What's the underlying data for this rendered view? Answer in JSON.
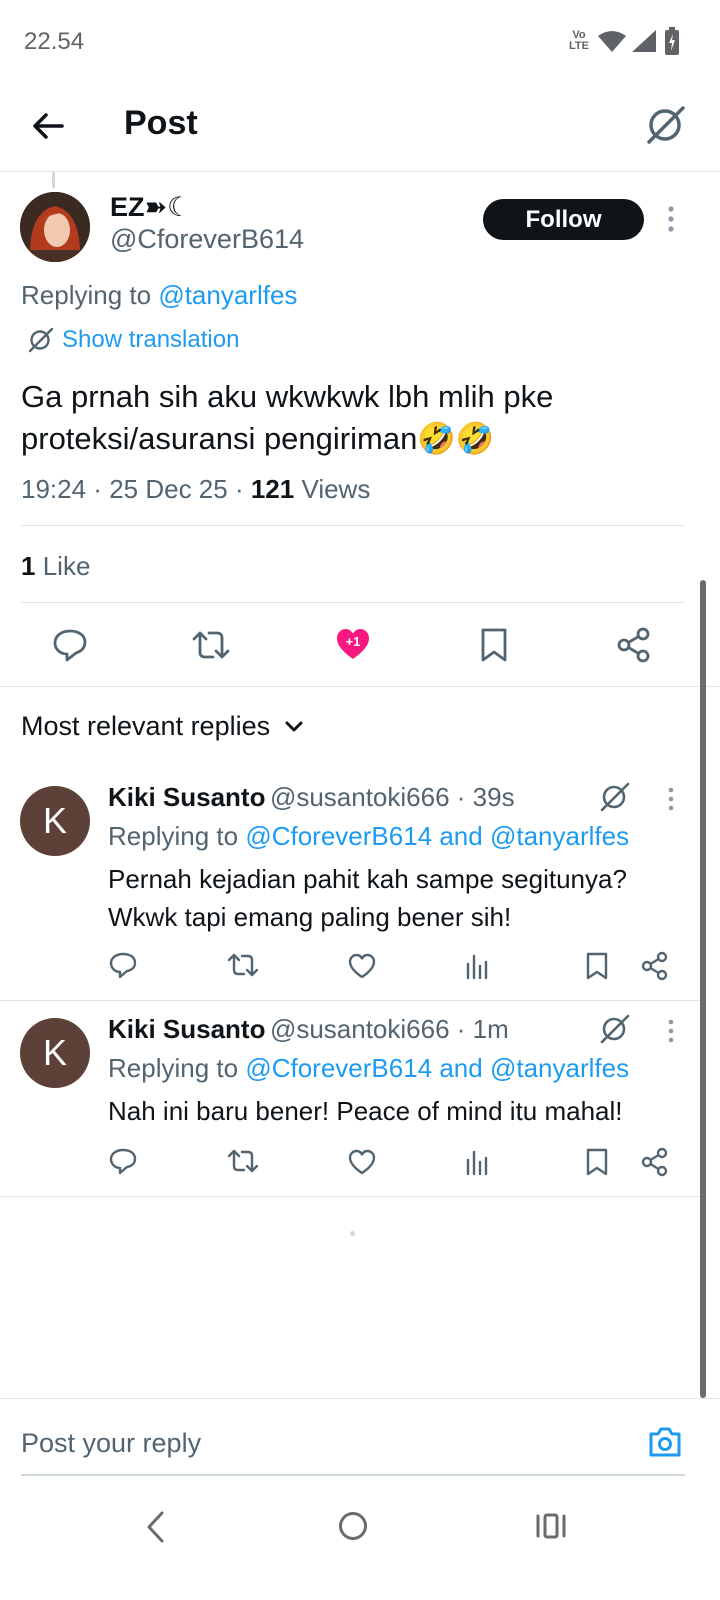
{
  "status_bar": {
    "time": "22.54",
    "network": "Vo LTE"
  },
  "header": {
    "title": "Post"
  },
  "tweet": {
    "author_name": "EZ➽☾",
    "handle": "@CforeverB614",
    "follow_label": "Follow",
    "replying_prefix": "Replying to",
    "replying_to": "@tanyarlfes",
    "show_translation": "Show translation",
    "text": "Ga prnah sih aku wkwkwk lbh mlih pke proteksi/asuransi pengiriman🤣🤣",
    "time": "19:24",
    "date": "25 Dec 25",
    "views_count": "121",
    "views_label": "Views",
    "likes_count": "1",
    "likes_label": "Like",
    "like_badge": "+1"
  },
  "replies_section": {
    "sort_label": "Most relevant replies"
  },
  "replies": [
    {
      "avatar_letter": "K",
      "name": "Kiki Susanto",
      "handle": "@susantoki666",
      "time": "39s",
      "replying_prefix": "Replying to",
      "replying_to": "@CforeverB614 and @tanyarlfes",
      "text": "Pernah kejadian pahit kah sampe segitunya? Wkwk tapi emang paling bener sih!"
    },
    {
      "avatar_letter": "K",
      "name": "Kiki Susanto",
      "handle": "@susantoki666",
      "time": "1m",
      "replying_prefix": "Replying to",
      "replying_to": "@CforeverB614 and @tanyarlfes",
      "text": "Nah ini baru bener! Peace of mind itu mahal!"
    }
  ],
  "composer": {
    "placeholder": "Post your reply"
  },
  "colors": {
    "accent": "#1d9bf0",
    "like": "#f91880",
    "follow_bg": "#0f1419",
    "avatar_k": "#5d4037"
  }
}
